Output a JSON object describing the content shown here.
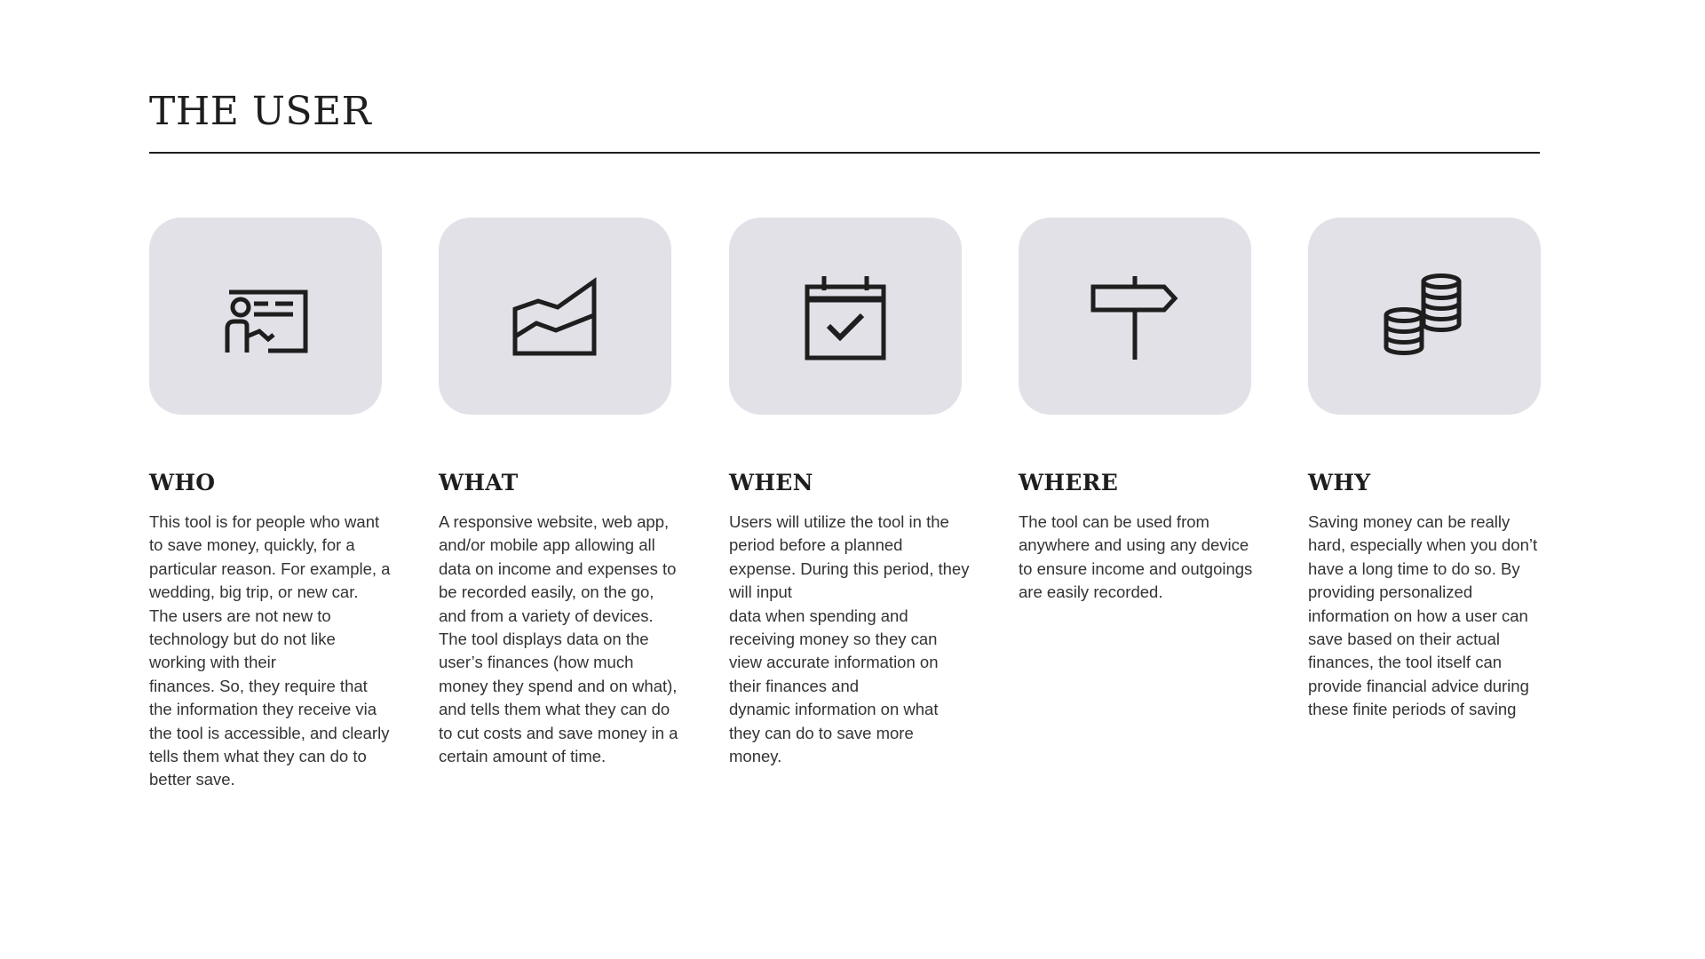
{
  "page": {
    "title": "THE USER"
  },
  "colors": {
    "tile_background": "#e3e1e8",
    "title_rule": "#1e1e1e",
    "text": "#333333"
  },
  "sections": [
    {
      "icon": "presentation-board-icon",
      "heading": "WHO",
      "body": "This tool is for people who want to save money, quickly, for a particular reason. For example, a\nwedding, big trip, or new car. The users are not new to technology but do not like working with their\nfinances. So, they require that the information they receive via the tool is accessible, and clearly tells them what they can do to better save."
    },
    {
      "icon": "area-chart-icon",
      "heading": "WHAT",
      "body": "A responsive website, web app, and/or mobile app allowing all data on income and expenses to be recorded easily, on the go, and from a variety of devices. The tool displays data on the user’s finances (how much money they spend and on what), and tells them what they can do to cut costs and save money in a certain amount of time."
    },
    {
      "icon": "calendar-check-icon",
      "heading": "WHEN",
      "body": "Users will utilize the tool in the period before a planned expense. During this period, they will input\ndata when spending and receiving money so they can view accurate information on their finances and\ndynamic information on what they can do to save more money."
    },
    {
      "icon": "signpost-icon",
      "heading": "WHERE",
      "body": "The tool can be used from anywhere and using any device to ensure income and outgoings are easily recorded."
    },
    {
      "icon": "coin-stacks-icon",
      "heading": "WHY",
      "body": "Saving money can be really hard, especially when you don’t have a long time to do so. By providing personalized information on how a user can save based on their actual finances, the tool itself can\nprovide financial advice during these finite periods of saving"
    }
  ]
}
